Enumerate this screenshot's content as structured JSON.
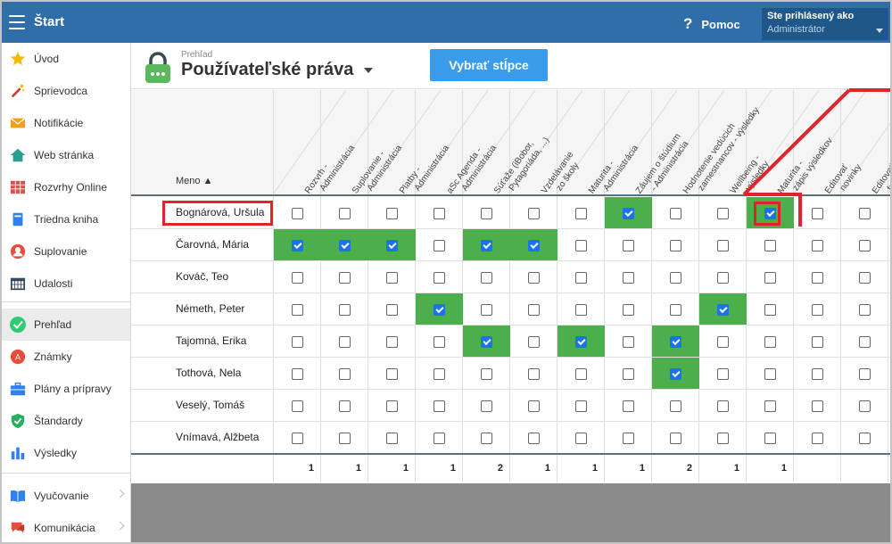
{
  "topbar": {
    "app_title": "Štart",
    "help_label": "Pomoc",
    "login_line1": "Ste prihlásený ako",
    "login_line2": "Administrátor"
  },
  "sidebar": {
    "items": [
      {
        "label": "Úvod",
        "icon": "star-icon",
        "chevron": false
      },
      {
        "label": "Sprievodca",
        "icon": "magic-wand-icon",
        "chevron": false
      },
      {
        "label": "Notifikácie",
        "icon": "envelope-icon",
        "chevron": false
      },
      {
        "label": "Web stránka",
        "icon": "house-icon",
        "chevron": false
      },
      {
        "label": "Rozvrhy Online",
        "icon": "timetable-icon",
        "chevron": false
      },
      {
        "label": "Triedna kniha",
        "icon": "book-icon",
        "chevron": false
      },
      {
        "label": "Suplovanie",
        "icon": "person-icon",
        "chevron": false
      },
      {
        "label": "Udalosti",
        "icon": "calendar-icon",
        "chevron": false
      },
      {
        "label": "Prehľad",
        "icon": "check-circle-icon",
        "chevron": false,
        "active": true
      },
      {
        "label": "Známky",
        "icon": "grade-icon",
        "chevron": false
      },
      {
        "label": "Plány a prípravy",
        "icon": "briefcase-icon",
        "chevron": false
      },
      {
        "label": "Štandardy",
        "icon": "shield-check-icon",
        "chevron": false
      },
      {
        "label": "Výsledky",
        "icon": "bar-chart-icon",
        "chevron": false
      },
      {
        "label": "Vyučovanie",
        "icon": "open-book-icon",
        "chevron": true
      },
      {
        "label": "Komunikácia",
        "icon": "chat-icon",
        "chevron": true
      }
    ]
  },
  "header": {
    "breadcrumb": "Prehľad",
    "title": "Používateľské práva",
    "select_columns_label": "Vybrať stĺpce"
  },
  "table": {
    "name_header": "Meno ▲",
    "columns": [
      "Rozvrh -\nAdministrácia",
      "Suplovanie -\nAdministrácia",
      "Platby -\nAdministrácia",
      "aSc Agenda -\nAdministrácia",
      "Súťaže (iBobor,\nPytagoriáda, ...)",
      "Vzdelávanie\nzo školy",
      "Maturita -\nAdministrácia",
      "Záujem o štúdium\n- Administrácia",
      "Hodnotenie vedúcich\nzamestnancov - výsledky",
      "Wellbeing -\nvýsledky",
      "Maturita -\nzápis výsledkov",
      "Editovať\nnovinky",
      "Editovať\nfoto"
    ],
    "rows": [
      {
        "name": "Bognárová, Uršula",
        "checks": [
          0,
          0,
          0,
          0,
          0,
          0,
          0,
          1,
          0,
          0,
          1,
          0,
          0
        ]
      },
      {
        "name": "Čarovná, Mária",
        "checks": [
          1,
          1,
          1,
          0,
          1,
          1,
          0,
          0,
          0,
          0,
          0,
          0,
          0
        ]
      },
      {
        "name": "Kováč, Teo",
        "checks": [
          0,
          0,
          0,
          0,
          0,
          0,
          0,
          0,
          0,
          0,
          0,
          0,
          0
        ]
      },
      {
        "name": "Németh, Peter",
        "checks": [
          0,
          0,
          0,
          1,
          0,
          0,
          0,
          0,
          0,
          1,
          0,
          0,
          0
        ]
      },
      {
        "name": "Tajomná, Erika",
        "checks": [
          0,
          0,
          0,
          0,
          1,
          0,
          1,
          0,
          1,
          0,
          0,
          0,
          0
        ]
      },
      {
        "name": "Tothová, Nela",
        "checks": [
          0,
          0,
          0,
          0,
          0,
          0,
          0,
          0,
          1,
          0,
          0,
          0,
          0
        ]
      },
      {
        "name": "Veselý, Tomáš",
        "checks": [
          0,
          0,
          0,
          0,
          0,
          0,
          0,
          0,
          0,
          0,
          0,
          0,
          0
        ]
      },
      {
        "name": "Vnímavá, Alžbeta",
        "checks": [
          0,
          0,
          0,
          0,
          0,
          0,
          0,
          0,
          0,
          0,
          0,
          0,
          0
        ]
      }
    ],
    "totals": [
      "1",
      "1",
      "1",
      "1",
      "2",
      "1",
      "1",
      "1",
      "2",
      "1",
      "1",
      "",
      ""
    ]
  },
  "colors": {
    "topbar": "#2f6ea9",
    "checked_cell": "#4cae4c",
    "highlight": "#e0242b",
    "button": "#3a9cea"
  }
}
